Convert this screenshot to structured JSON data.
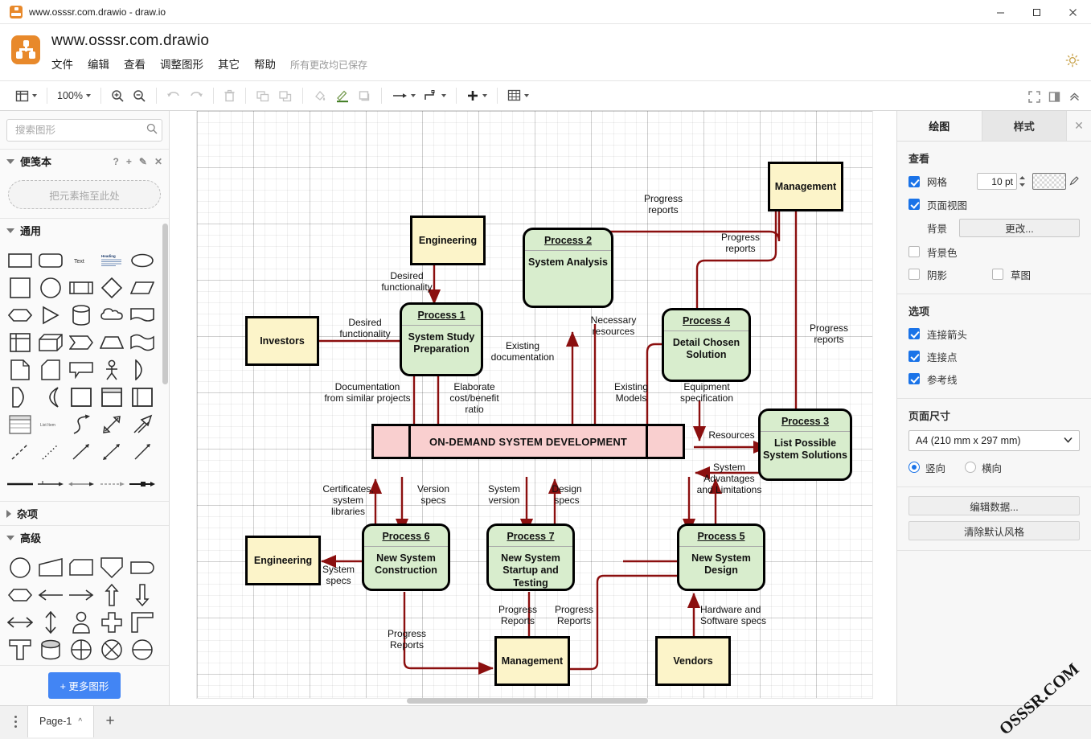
{
  "window": {
    "title": "www.osssr.com.drawio - draw.io",
    "minimize": "–",
    "maximize": "☐",
    "close": "✕"
  },
  "header": {
    "filename": "www.osssr.com.drawio",
    "menu": [
      "文件",
      "编辑",
      "查看",
      "调整图形",
      "其它",
      "帮助"
    ],
    "saved_status": "所有更改均已保存",
    "theme_icon": "sun-icon"
  },
  "toolbar": {
    "view_icon": "view-layout-icon",
    "zoom_level": "100%",
    "zoom_in_icon": "zoom-in-icon",
    "zoom_out_icon": "zoom-out-icon",
    "undo_icon": "undo-icon",
    "redo_icon": "redo-icon",
    "delete_icon": "trash-icon",
    "to_front_icon": "bring-to-front-icon",
    "to_back_icon": "send-to-back-icon",
    "fill_icon": "fill-color-icon",
    "line_icon": "line-color-icon",
    "shadow_icon": "shadow-icon",
    "connection_icon": "connection-arrow-icon",
    "waypoint_icon": "waypoint-icon",
    "insert_icon": "plus-icon",
    "table_icon": "table-icon",
    "fullscreen_icon": "fullscreen-icon",
    "panel_icon": "toggle-panel-icon",
    "collapse_icon": "collapse-icon"
  },
  "sidebar": {
    "search_placeholder": "搜索图形",
    "search_value": "",
    "search_icon": "search-icon",
    "sections": [
      {
        "title": "便笺本",
        "expanded": true,
        "actions": [
          "?",
          "+",
          "✎",
          "✕"
        ],
        "dropzone": "把元素拖至此处"
      },
      {
        "title": "通用",
        "expanded": true
      },
      {
        "title": "杂项",
        "expanded": false
      },
      {
        "title": "高级",
        "expanded": true
      }
    ],
    "more_shapes": "+ 更多图形"
  },
  "format_panel": {
    "tabs": [
      {
        "label": "绘图",
        "active": true
      },
      {
        "label": "样式",
        "active": false
      }
    ],
    "close_icon": "close-icon",
    "view": {
      "title": "查看",
      "grid": {
        "label": "网格",
        "checked": true,
        "size": "10 pt",
        "color_icon": "grid-color-swatch",
        "pen_icon": "eyedropper-icon"
      },
      "page_view": {
        "label": "页面视图",
        "checked": true
      },
      "background": {
        "label": "背景",
        "button": "更改..."
      },
      "background_color": {
        "label": "背景色",
        "checked": false
      },
      "shadow": {
        "label": "阴影",
        "checked": false
      },
      "sketch": {
        "label": "草图",
        "checked": false
      }
    },
    "options": {
      "title": "选项",
      "items": [
        {
          "label": "连接箭头",
          "checked": true
        },
        {
          "label": "连接点",
          "checked": true
        },
        {
          "label": "参考线",
          "checked": true
        }
      ]
    },
    "page_size": {
      "title": "页面尺寸",
      "selected": "A4 (210 mm x 297 mm)",
      "orientation": [
        {
          "label": "竖向",
          "selected": true
        },
        {
          "label": "横向",
          "selected": false
        }
      ]
    },
    "buttons": [
      "编辑数据...",
      "清除默认风格"
    ]
  },
  "footer": {
    "menu_icon": "kebab-menu-icon",
    "page_tab": "Page-1",
    "page_chevron": "^",
    "add_page": "+"
  },
  "watermark": "OSSSR.COM",
  "diagram": {
    "center": {
      "label": "ON-DEMAND SYSTEM DEVELOPMENT"
    },
    "externals": [
      {
        "id": "investors",
        "label": "Investors"
      },
      {
        "id": "engineering_top",
        "label": "Engineering"
      },
      {
        "id": "management_top",
        "label": "Management"
      },
      {
        "id": "engineering_bottom",
        "label": "Engineering"
      },
      {
        "id": "management_bottom",
        "label": "Management"
      },
      {
        "id": "vendors",
        "label": "Vendors"
      }
    ],
    "processes": [
      {
        "id": "p1",
        "title": "Process 1",
        "body": "System Study\nPreparation"
      },
      {
        "id": "p2",
        "title": "Process 2",
        "body": "System Analysis"
      },
      {
        "id": "p3",
        "title": "Process 3",
        "body": "List Possible\nSystem Solutions"
      },
      {
        "id": "p4",
        "title": "Process 4",
        "body": "Detail Chosen\nSolution"
      },
      {
        "id": "p5",
        "title": "Process 5",
        "body": "New System\nDesign"
      },
      {
        "id": "p6",
        "title": "Process 6",
        "body": "New\nSystem\nConstruction"
      },
      {
        "id": "p7",
        "title": "Process 7",
        "body": "New System\nStartup and\nTesting"
      }
    ],
    "edge_labels": [
      {
        "id": "l_desired_func_left",
        "text": "Desired\nfunctionality"
      },
      {
        "id": "l_desired_func_top",
        "text": "Desired\nfunctionality"
      },
      {
        "id": "l_progress_top1",
        "text": "Progress\nreports"
      },
      {
        "id": "l_progress_top2",
        "text": "Progress\nreports"
      },
      {
        "id": "l_progress_right",
        "text": "Progress\nreports"
      },
      {
        "id": "l_existing_doc",
        "text": "Existing\ndocumentation"
      },
      {
        "id": "l_necessary_res",
        "text": "Necessary\nresources"
      },
      {
        "id": "l_doc_similar",
        "text": "Documentation\nfrom similar projects"
      },
      {
        "id": "l_elaborate",
        "text": "Elaborate\ncost/benefit\nratio"
      },
      {
        "id": "l_existing_models",
        "text": "Existing\nModels"
      },
      {
        "id": "l_equipment_spec",
        "text": "Equipment\nspecification"
      },
      {
        "id": "l_resources",
        "text": "Resources"
      },
      {
        "id": "l_sys_adv",
        "text": "System\nAdvantages\nand Limitations"
      },
      {
        "id": "l_certificates",
        "text": "Certificates,\nsystem\nlibraries"
      },
      {
        "id": "l_version_specs",
        "text": "Version\nspecs"
      },
      {
        "id": "l_system_version",
        "text": "System\nversion"
      },
      {
        "id": "l_design_specs",
        "text": "Design\nspecs"
      },
      {
        "id": "l_system_specs",
        "text": "System\nspecs"
      },
      {
        "id": "l_progress_rep_6",
        "text": "Progress\nReports"
      },
      {
        "id": "l_progress_rep_7",
        "text": "Progress\nReports"
      },
      {
        "id": "l_progress_rep_5",
        "text": "Progress\nReports"
      },
      {
        "id": "l_hardware",
        "text": "Hardware and\nSoftware specs"
      }
    ],
    "colors": {
      "process_fill": "#d8edcd",
      "external_fill": "#fcf4c9",
      "center_fill": "#f9cfcf",
      "edge": "#8b0f0f",
      "stroke": "#000000"
    }
  }
}
